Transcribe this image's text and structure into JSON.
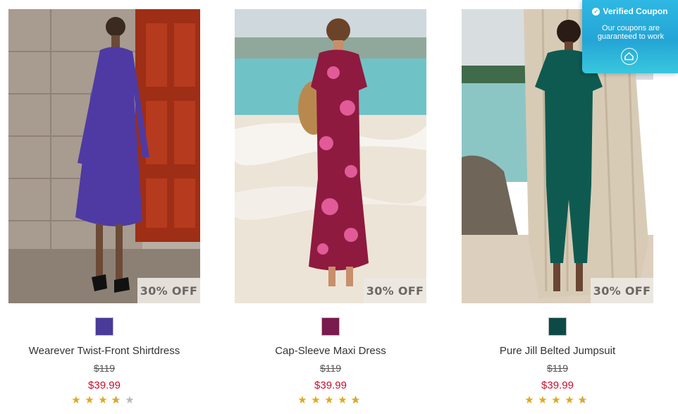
{
  "products": [
    {
      "name": "Wearever Twist-Front Shirtdress",
      "was_price": "$119",
      "sale_price": "$39.99",
      "badge": "30% OFF",
      "swatch_color": "#4a3a99",
      "rating": 3.5
    },
    {
      "name": "Cap-Sleeve Maxi Dress",
      "was_price": "$119",
      "sale_price": "$39.99",
      "badge": "30% OFF",
      "swatch_color": "#7a1a4e",
      "rating": 4.5
    },
    {
      "name": "Pure Jill Belted Jumpsuit",
      "was_price": "$119",
      "sale_price": "$39.99",
      "badge": "30% OFF",
      "swatch_color": "#0d4a47",
      "rating": 4.5
    }
  ],
  "coupon": {
    "title": "Verified Coupon",
    "subtitle": "Our coupons are guaranteed to work"
  },
  "colors": {
    "sale_price": "#c8102e",
    "star": "#e0a91e",
    "coupon_bg": "#24a5d6"
  }
}
